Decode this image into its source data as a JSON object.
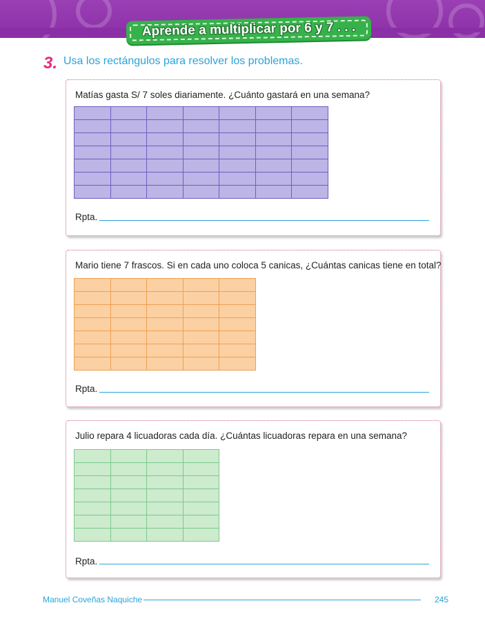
{
  "header": {
    "title": "Aprende a multiplicar por 6 y 7 . . ."
  },
  "exercise": {
    "number": "3.",
    "instruction": "Usa los rectángulos para resolver los problemas."
  },
  "problems": [
    {
      "question": "Matías gasta S/ 7 soles diariamente. ¿Cuánto gastará en una semana?",
      "grid_rows": 7,
      "grid_cols": 7,
      "grid_color": "#bcb5e6",
      "answer_label": "Rpta."
    },
    {
      "question": "Mario tiene 7 frascos. Si en cada uno coloca 5 canicas, ¿Cuántas canicas tiene en total?",
      "grid_rows": 7,
      "grid_cols": 5,
      "grid_color": "#fbd0a3",
      "answer_label": "Rpta."
    },
    {
      "question": "Julio repara 4 licuadoras cada día. ¿Cuántas licuadoras repara en una semana?",
      "grid_rows": 7,
      "grid_cols": 4,
      "grid_color": "#cdebcd",
      "answer_label": "Rpta."
    }
  ],
  "footer": {
    "author": "Manuel Coveñas Naquiche",
    "page_number": "245"
  },
  "colors": {
    "header_purple": "#9b3fb5",
    "banner_green": "#36b24a",
    "accent_blue": "#29a3d8",
    "accent_pink": "#e6287d"
  }
}
